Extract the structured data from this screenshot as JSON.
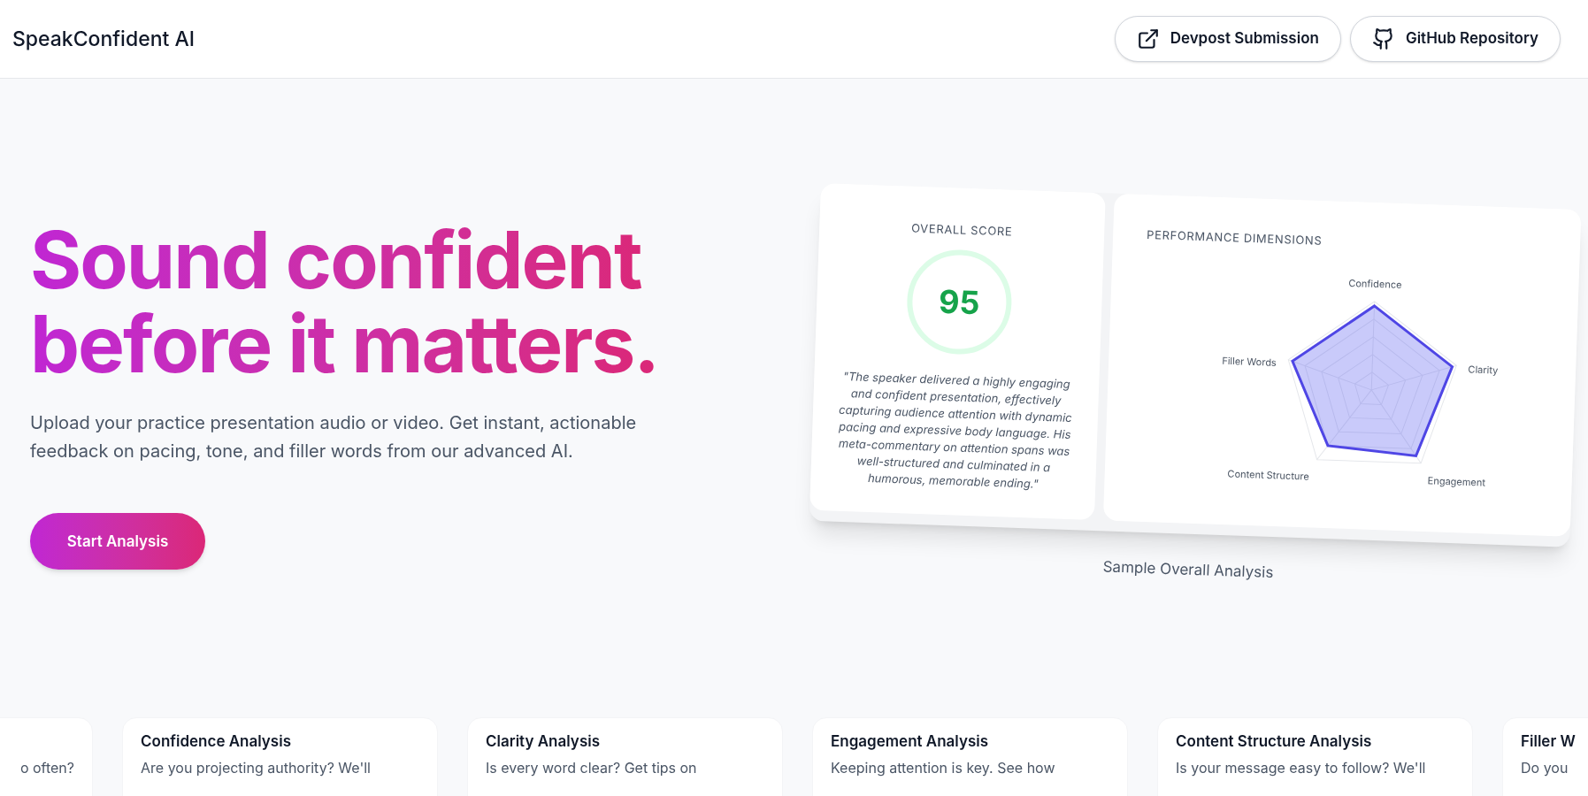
{
  "header": {
    "brand": "SpeakConfident AI",
    "links": [
      {
        "kind": "external",
        "label": "Devpost Submission"
      },
      {
        "kind": "github",
        "label": "GitHub Repository"
      }
    ]
  },
  "hero": {
    "headline": [
      "Sound confident",
      "before it matters."
    ],
    "subtitle": "Upload your practice presentation audio or video. Get instant, actionable feedback on pacing, tone, and filler words from our advanced AI.",
    "cta": "Start Analysis"
  },
  "sample": {
    "score_title": "OVERALL SCORE",
    "score": "95",
    "summary": "\"The speaker delivered a highly engaging and confident presentation, effectively capturing audience attention with dynamic pacing and expressive body language. His meta-commentary on attention spans was well-structured and culminated in a humorous, memorable ending.\"",
    "dimensions_title": "PERFORMANCE DIMENSIONS",
    "axes": [
      "Confidence",
      "Filler Words",
      "Clarity",
      "Content Structure",
      "Engagement"
    ],
    "caption": "Sample Overall Analysis"
  },
  "features": [
    {
      "text": "o often?"
    },
    {
      "title": "Confidence Analysis",
      "text": "Are you projecting authority? We'll"
    },
    {
      "title": "Clarity Analysis",
      "text": "Is every word clear? Get tips on"
    },
    {
      "title": "Engagement Analysis",
      "text": "Keeping attention is key. See how"
    },
    {
      "title": "Content Structure Analysis",
      "text": "Is your message easy to follow? We'll"
    },
    {
      "title": "Filler W",
      "text": "Do you"
    }
  ]
}
